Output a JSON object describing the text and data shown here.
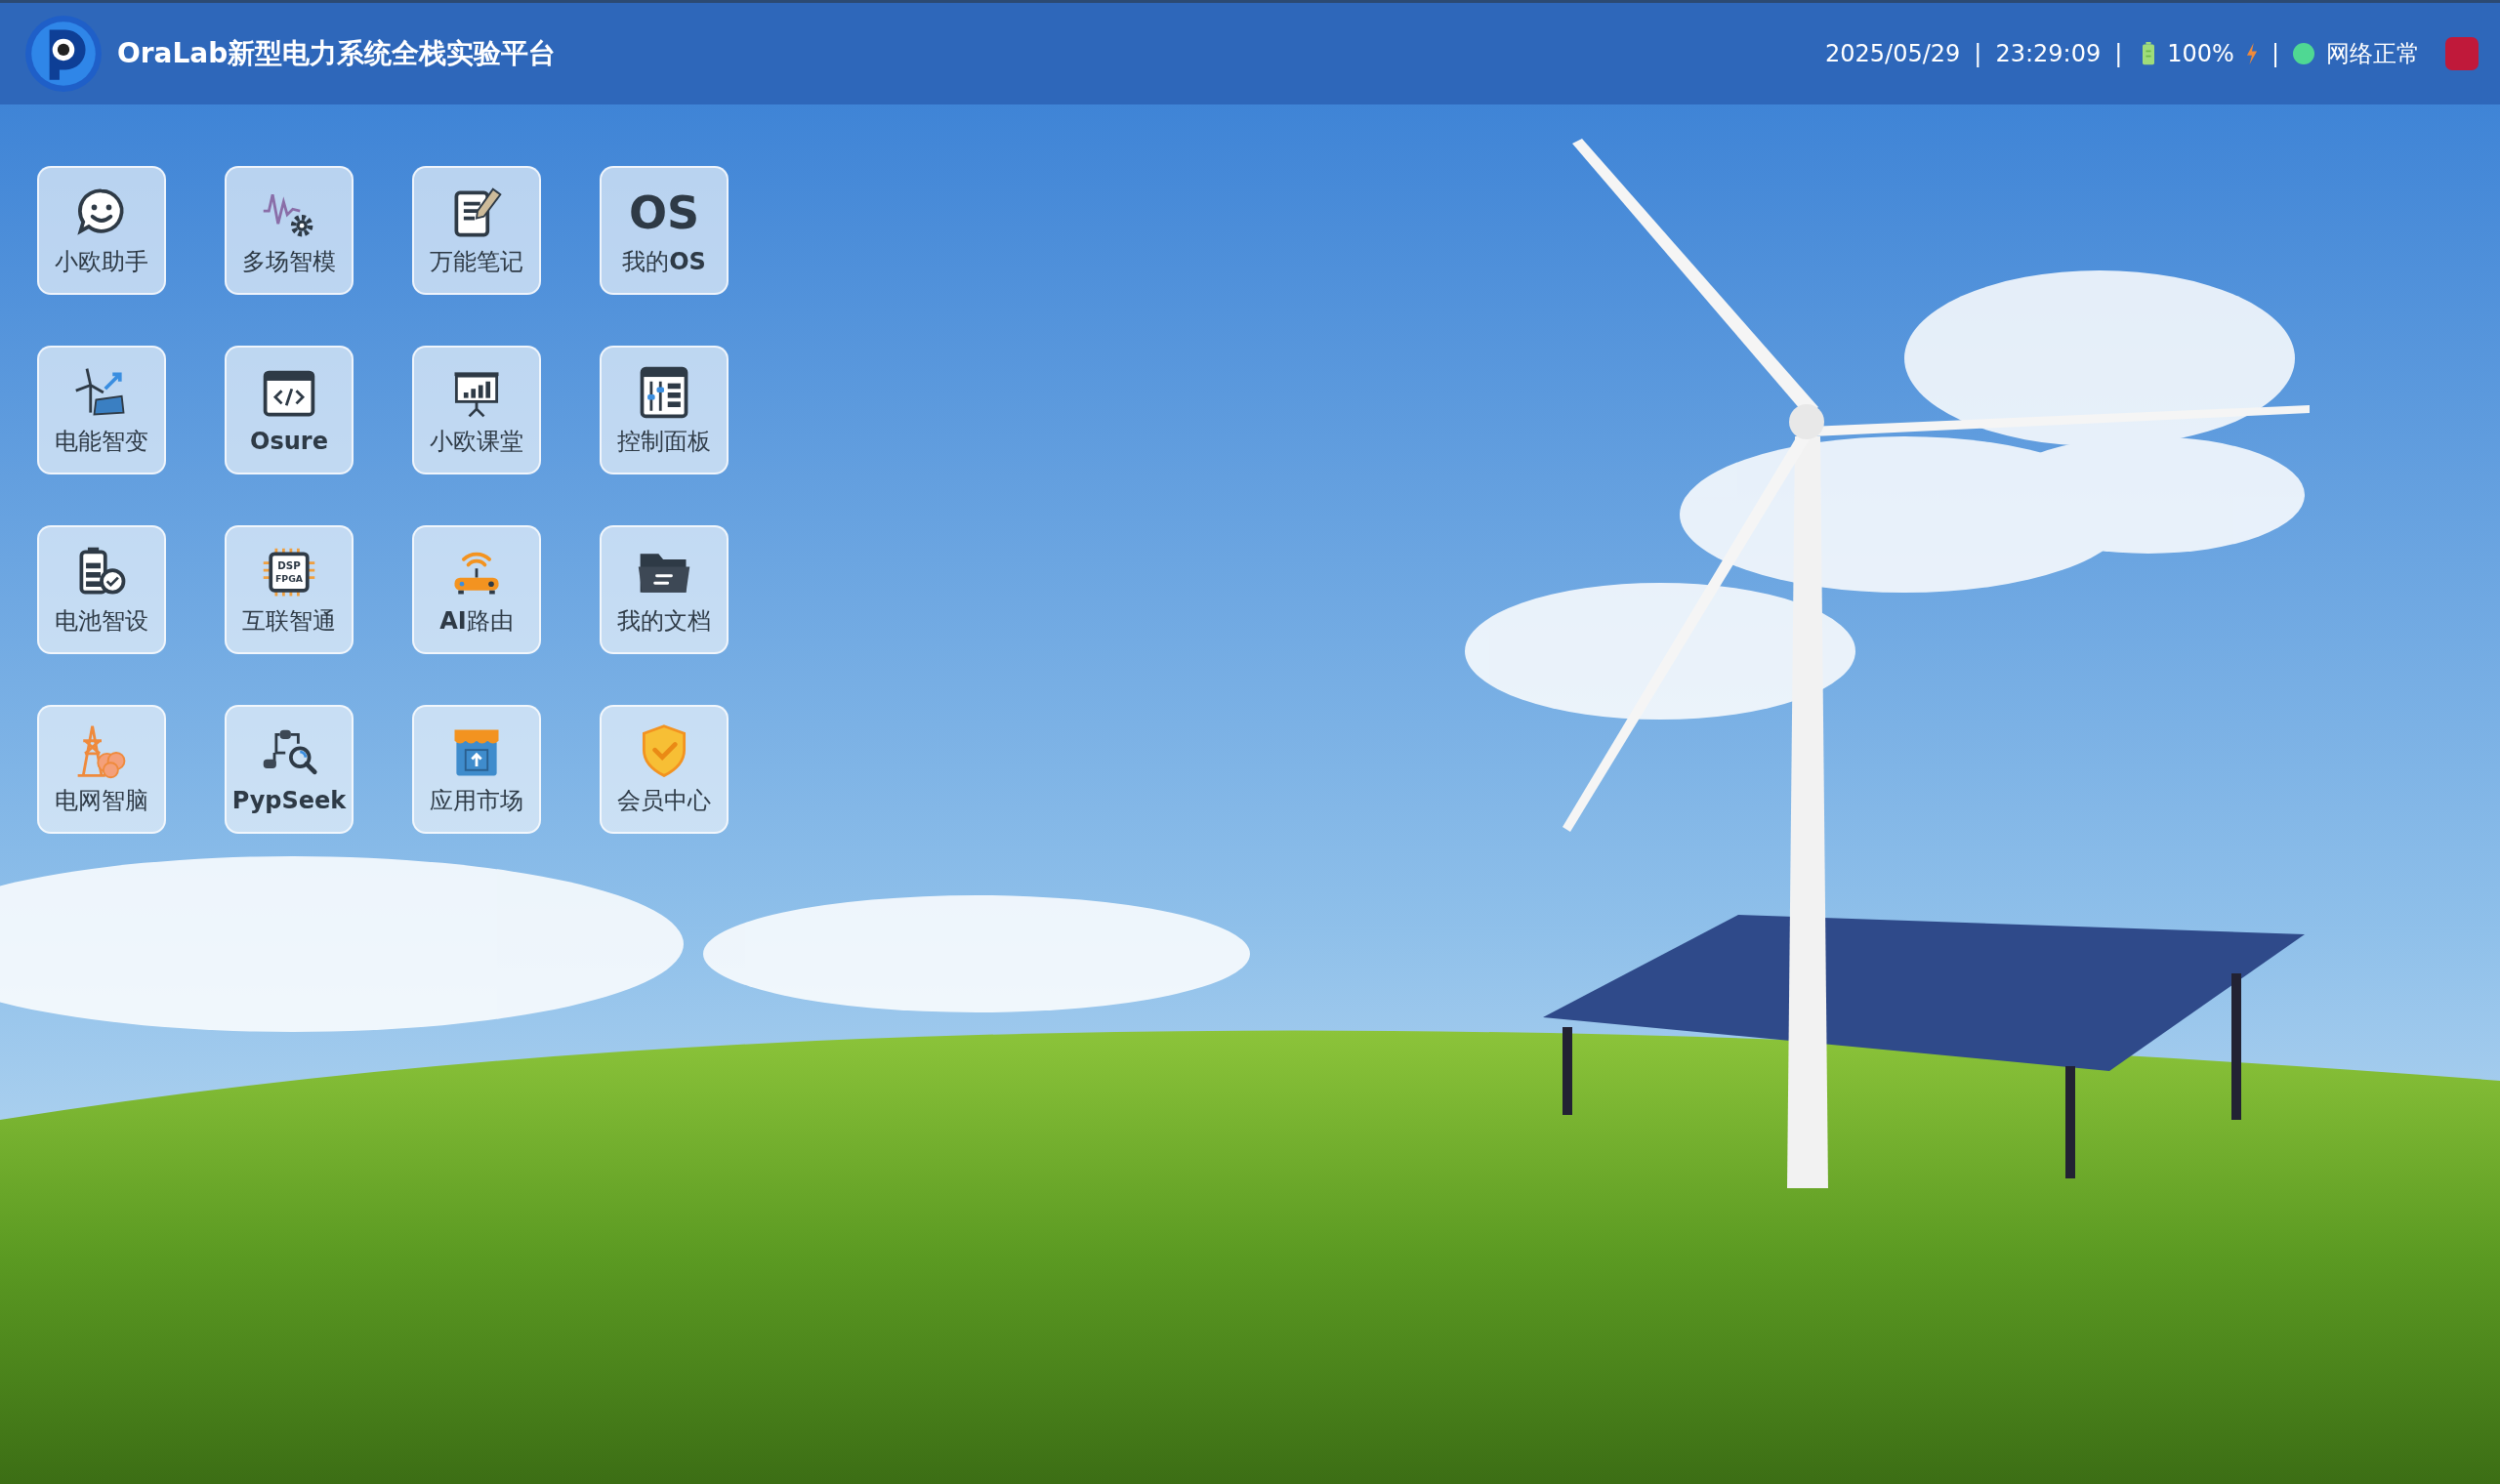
{
  "header": {
    "title": "OraLab新型电力系统全栈实验平台",
    "status": {
      "date": "2025/05/29",
      "separator_1": "|",
      "time": "23:29:09",
      "separator_2": "|",
      "battery": "100%",
      "charging": true,
      "separator_3": "|",
      "network_online": true,
      "network": "网络正常"
    }
  },
  "apps": [
    {
      "label": "小欧助手",
      "bold": false
    },
    {
      "label": "多场智模",
      "bold": false
    },
    {
      "label": "万能笔记",
      "bold": false
    },
    {
      "label": "我的**OS**",
      "bold": false,
      "icon_text": [
        "OS"
      ]
    },
    {
      "label": "电能智变",
      "bold": false
    },
    {
      "label": "Osure",
      "bold": true
    },
    {
      "label": "小欧课堂",
      "bold": false
    },
    {
      "label": "控制面板",
      "bold": false
    },
    {
      "label": "电池智设",
      "bold": false
    },
    {
      "label": "互联智通",
      "bold": false,
      "icon_text": [
        "DSP",
        "FPGA"
      ]
    },
    {
      "label": "**AI**路由",
      "bold": false
    },
    {
      "label": "我的文档",
      "bold": false
    },
    {
      "label": "电网智脑",
      "bold": false
    },
    {
      "label": "PypSeek",
      "bold": true
    },
    {
      "label": "应用市场",
      "bold": false
    },
    {
      "label": "会员中心",
      "bold": false
    }
  ]
}
